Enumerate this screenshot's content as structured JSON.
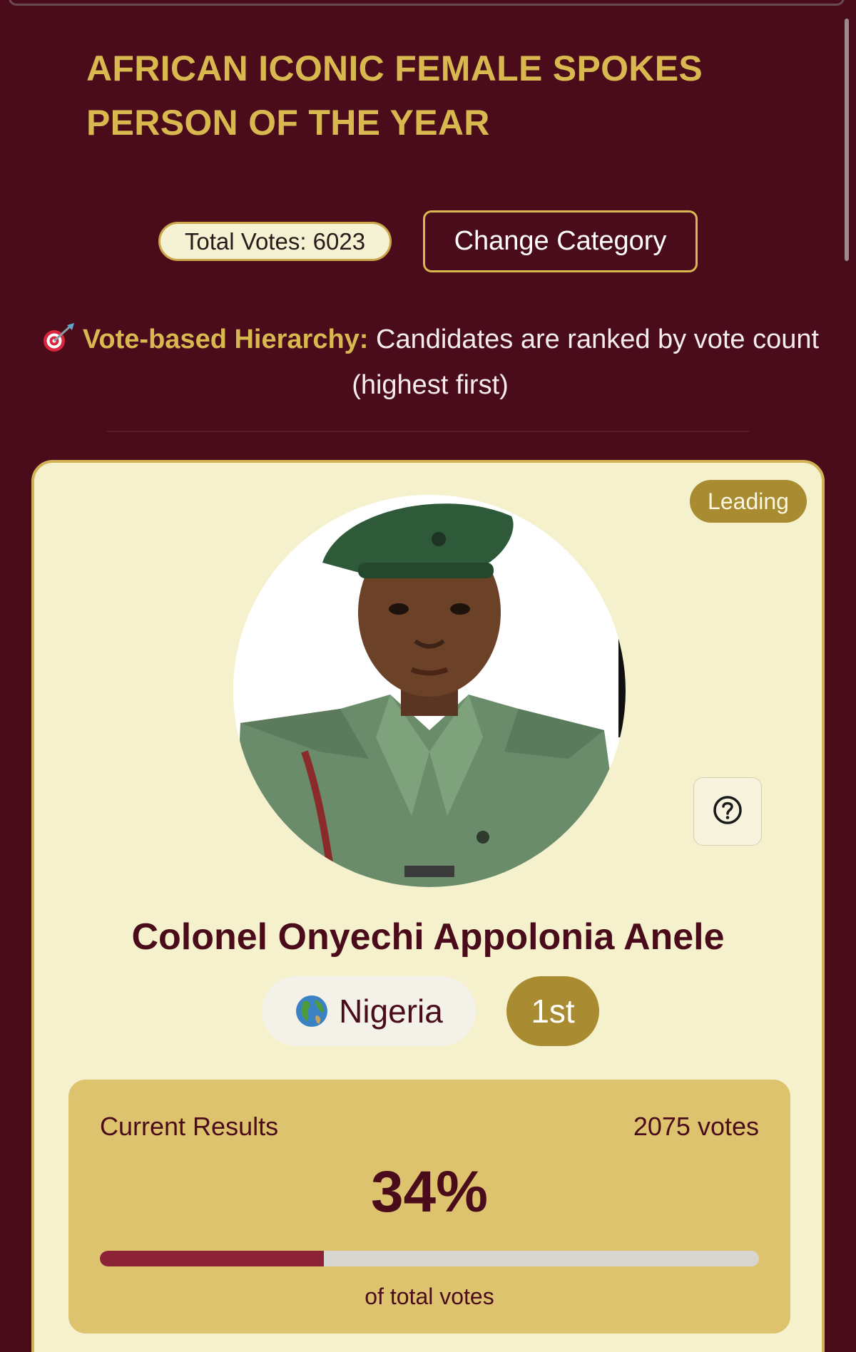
{
  "category": {
    "title": "AFRICAN ICONIC FEMALE SPOKES PERSON OF THE YEAR"
  },
  "toolbar": {
    "total_votes_label": "Total Votes: 6023",
    "change_category_label": "Change Category"
  },
  "hierarchy_note": {
    "icon": "target-icon",
    "highlight": "Vote-based Hierarchy:",
    "text": "Candidates are ranked by vote count (highest first)"
  },
  "candidate": {
    "status_badge": "Leading",
    "name": "Colonel Onyechi Appolonia Anele",
    "country": "Nigeria",
    "country_icon": "globe-icon",
    "rank": "1st",
    "results": {
      "label": "Current Results",
      "votes": "2075 votes",
      "percent_text": "34%",
      "percent_value": 34,
      "caption": "of total votes"
    }
  },
  "help": {
    "icon": "question-circle-icon"
  },
  "colors": {
    "background": "#4a0c1b",
    "accent_gold": "#d8b84f",
    "card_bg": "#f6f1cd",
    "results_bg": "#ddc36e",
    "progress_fill": "#8c2238"
  }
}
